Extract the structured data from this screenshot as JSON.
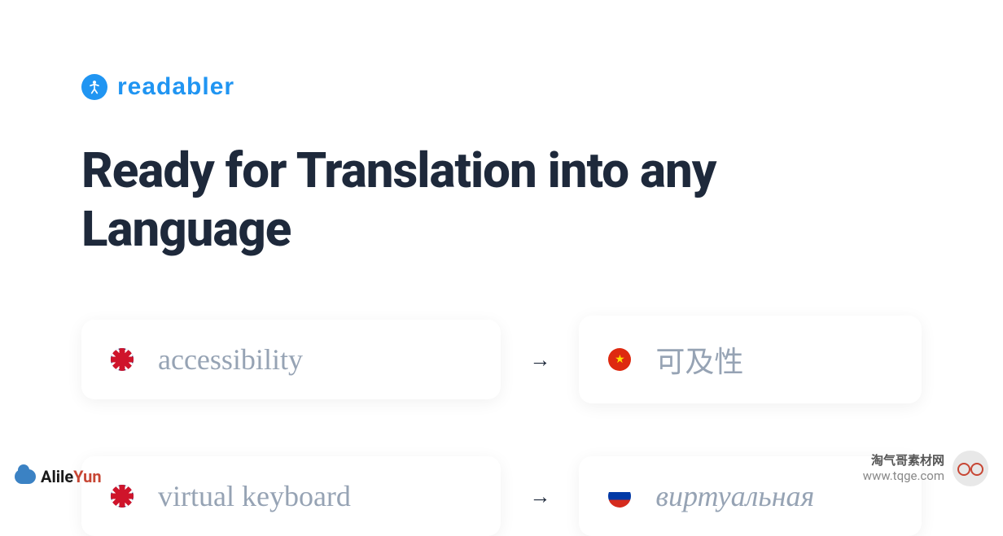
{
  "brand": {
    "name": "readabler",
    "icon": "accessibility-icon"
  },
  "heading": "Ready for Translation into any Language",
  "translations": [
    {
      "source": {
        "flag": "uk",
        "text": "accessibility"
      },
      "target": {
        "flag": "cn",
        "text": "可及性"
      }
    },
    {
      "source": {
        "flag": "uk",
        "text": "virtual keyboard"
      },
      "target": {
        "flag": "ru",
        "text": "виртуальная"
      }
    }
  ],
  "watermark_left": {
    "text": "Alile",
    "suffix": "Yun"
  },
  "watermark_right": {
    "line1": "淘气哥素材网",
    "line2": "www.tqge.com"
  }
}
